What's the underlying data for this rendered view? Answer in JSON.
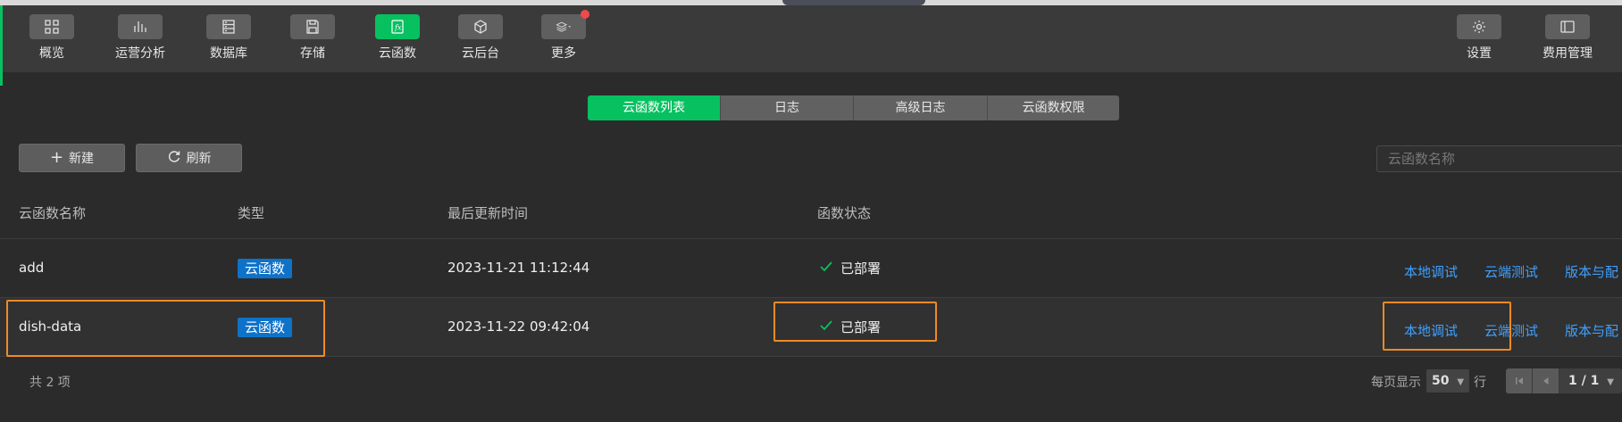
{
  "toolbar": {
    "items": [
      {
        "label": "概览",
        "icon": "grid-icon"
      },
      {
        "label": "运营分析",
        "icon": "bar-chart-icon"
      },
      {
        "label": "数据库",
        "icon": "database-icon"
      },
      {
        "label": "存储",
        "icon": "floppy-icon"
      },
      {
        "label": "云函数",
        "icon": "function-icon"
      },
      {
        "label": "云后台",
        "icon": "cube-icon"
      },
      {
        "label": "更多",
        "icon": "layers-icon"
      }
    ],
    "right_items": [
      {
        "label": "设置",
        "icon": "gear-icon"
      },
      {
        "label": "费用管理",
        "icon": "panel-icon"
      }
    ],
    "active": "云函数",
    "accent_color": "#07c160"
  },
  "tabs": {
    "items": [
      "云函数列表",
      "日志",
      "高级日志",
      "云函数权限"
    ],
    "active": "云函数列表"
  },
  "actions": {
    "new_label": "新建",
    "refresh_label": "刷新",
    "search_placeholder": "云函数名称"
  },
  "table": {
    "headers": [
      "云函数名称",
      "类型",
      "最后更新时间",
      "函数状态"
    ],
    "rows": [
      {
        "name": "add",
        "type": "云函数",
        "updated": "2023-11-21 11:12:44",
        "status": "已部署",
        "actions": [
          "本地调试",
          "云端测试",
          "版本与配"
        ]
      },
      {
        "name": "dish-data",
        "type": "云函数",
        "updated": "2023-11-22 09:42:04",
        "status": "已部署",
        "actions": [
          "本地调试",
          "云端测试",
          "版本与配"
        ]
      }
    ]
  },
  "footer": {
    "total": "共 2 项",
    "per_page_label": "每页显示",
    "per_page_value": "50",
    "per_page_unit": "行",
    "page_indicator": "1 / 1"
  }
}
